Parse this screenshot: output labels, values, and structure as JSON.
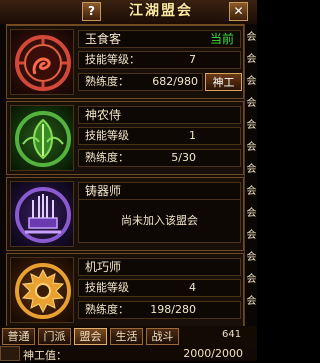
{
  "window": {
    "title": "江湖盟会",
    "help_label": "?",
    "close_label": "✕"
  },
  "professions": [
    {
      "name": "玉食客",
      "status": "当前",
      "skill_label": "技能等级：",
      "skill_level": "7",
      "proficiency_label": "熟练度：",
      "proficiency": "682/980",
      "action_label": "神工",
      "emblem": "dragon-emblem-icon",
      "color": "#d2493a"
    },
    {
      "name": "神农侍",
      "skill_label": "技能等级",
      "skill_level": "1",
      "proficiency_label": "熟练度：",
      "proficiency": "5/30",
      "emblem": "leaf-emblem-icon",
      "color": "#56b23e"
    },
    {
      "name": "铸器师",
      "not_joined": "尚未加入该盟会",
      "emblem": "forge-emblem-icon",
      "color": "#8a5ad0"
    },
    {
      "name": "机巧师",
      "skill_label": "技能等级",
      "skill_level": "4",
      "proficiency_label": "熟练度：",
      "proficiency": "198/280",
      "emblem": "gear-emblem-icon",
      "color": "#e8a030"
    }
  ],
  "right_column": [
    "会",
    "会",
    "会",
    "会",
    "会",
    "会",
    "会",
    "会",
    "会",
    "会",
    "会",
    "会",
    "会"
  ],
  "tabs": [
    "普通",
    "门派",
    "盟会",
    "生活",
    "战斗"
  ],
  "tab_count": "641",
  "bottom": {
    "label": "神工值：",
    "value": "2000/2000"
  }
}
